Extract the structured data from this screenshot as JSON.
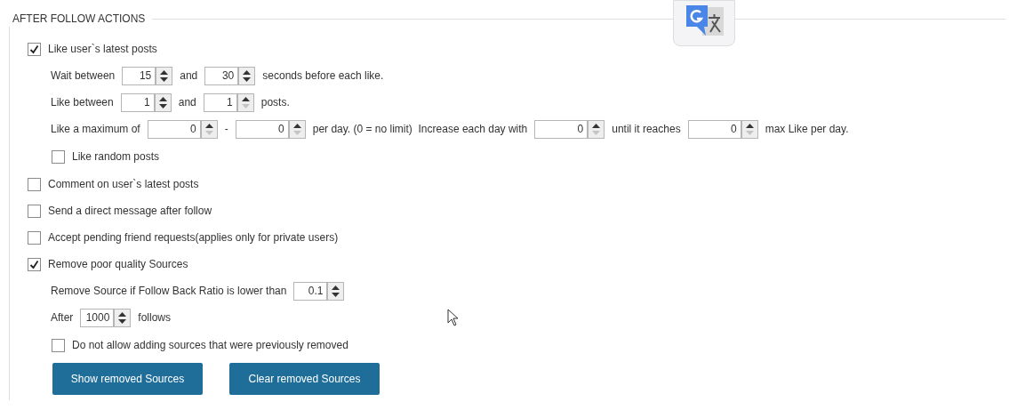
{
  "section": {
    "title": "AFTER FOLLOW ACTIONS"
  },
  "options": [
    {
      "label": "Like user`s latest posts",
      "checked": true,
      "settings": [
        {
          "kind": "line",
          "parts": [
            {
              "kind": "text",
              "text": "Wait between"
            },
            {
              "kind": "spinner",
              "value": "15",
              "down_disabled": false
            },
            {
              "kind": "text",
              "text": "and"
            },
            {
              "kind": "spinner",
              "value": "30",
              "down_disabled": false
            },
            {
              "kind": "text",
              "text": "seconds before each like."
            }
          ]
        },
        {
          "kind": "line",
          "parts": [
            {
              "kind": "text",
              "text": "Like between"
            },
            {
              "kind": "spinner",
              "value": "1",
              "down_disabled": false
            },
            {
              "kind": "text",
              "text": "and"
            },
            {
              "kind": "spinner",
              "value": "1",
              "down_disabled": true
            },
            {
              "kind": "text",
              "text": "posts."
            }
          ]
        },
        {
          "kind": "line",
          "parts": [
            {
              "kind": "text",
              "text": "Like a maximum of"
            },
            {
              "kind": "wide_spinner",
              "value": "0",
              "down_disabled": true
            },
            {
              "kind": "text",
              "text": "-"
            },
            {
              "kind": "wide_spinner",
              "value": "0",
              "down_disabled": true
            },
            {
              "kind": "text",
              "text": "per day. (0 = no limit)  Increase each day with"
            },
            {
              "kind": "wide_spinner",
              "value": "0",
              "down_disabled": true
            },
            {
              "kind": "text",
              "text": "until it reaches"
            },
            {
              "kind": "wide_spinner",
              "value": "0",
              "down_disabled": true
            },
            {
              "kind": "text",
              "text": "max Like per day."
            }
          ]
        },
        {
          "kind": "checkbox",
          "label": "Like random posts",
          "checked": false
        }
      ]
    },
    {
      "label": "Comment on user`s latest posts",
      "checked": false
    },
    {
      "label": "Send a direct message after follow",
      "checked": false
    },
    {
      "label": "Accept pending friend requests(applies only for private users)",
      "checked": false
    },
    {
      "label": "Remove poor quality Sources",
      "checked": true,
      "settings": [
        {
          "kind": "line",
          "parts": [
            {
              "kind": "text",
              "text": "Remove Source if Follow Back Ratio is lower than"
            },
            {
              "kind": "spinner",
              "value": "0.1",
              "down_disabled": false
            }
          ]
        },
        {
          "kind": "line",
          "parts": [
            {
              "kind": "text",
              "text": "After"
            },
            {
              "kind": "spinner",
              "value": "1000",
              "down_disabled": false
            },
            {
              "kind": "text",
              "text": "follows"
            }
          ]
        },
        {
          "kind": "checkbox",
          "label": "Do not allow adding sources that were previously removed",
          "checked": false
        }
      ]
    }
  ],
  "buttons": [
    {
      "label": "Show removed Sources"
    },
    {
      "label": "Clear removed Sources"
    }
  ]
}
